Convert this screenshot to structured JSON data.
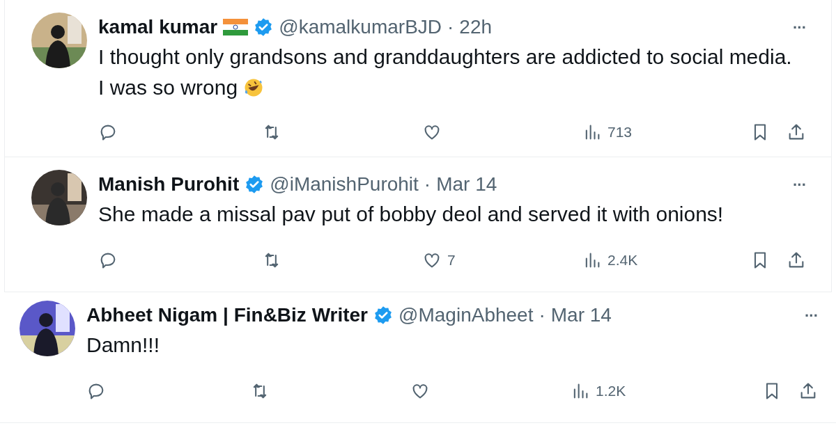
{
  "tweets": [
    {
      "name": "kamal kumar",
      "flag": true,
      "verified": true,
      "handle": "@kamalkumarBJD",
      "separator": "·",
      "time": "22h",
      "more": "···",
      "text": "I thought only grandsons and granddaughters are addicted to social media. I was so wrong",
      "trailing_emoji": true,
      "views": "713"
    },
    {
      "name": "Manish Purohit",
      "flag": false,
      "verified": true,
      "handle": "@iManishPurohit",
      "separator": "·",
      "time": "Mar 14",
      "more": "···",
      "text": "She made a missal pav put of bobby deol and served it with onions!",
      "trailing_emoji": false,
      "likes": "7",
      "views": "2.4K"
    },
    {
      "name": "Abheet Nigam | Fin&Biz Writer",
      "flag": false,
      "verified": true,
      "handle": "@MaginAbheet",
      "separator": "·",
      "time": "Mar 14",
      "more": "···",
      "text": "Damn!!!",
      "trailing_emoji": false,
      "views": "1.2K"
    }
  ]
}
